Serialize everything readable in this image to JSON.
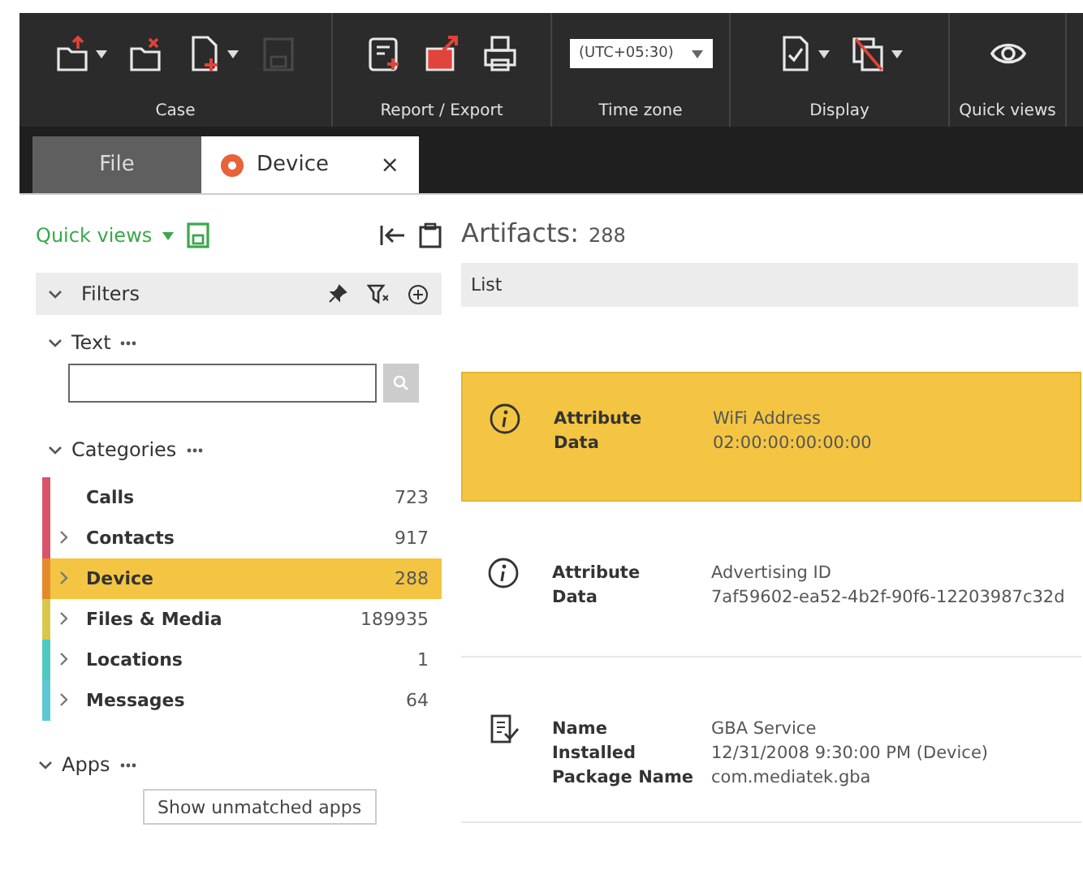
{
  "toolbar": {
    "groups": [
      {
        "label": "Case",
        "buttons": [
          {
            "kind": "open",
            "dropdown": true,
            "disabled": false
          },
          {
            "kind": "close",
            "dropdown": false,
            "disabled": false
          },
          {
            "kind": "new",
            "dropdown": true,
            "disabled": false
          },
          {
            "kind": "save",
            "dropdown": false,
            "disabled": true
          }
        ]
      },
      {
        "label": "Report / Export",
        "buttons": [
          {
            "kind": "report",
            "dropdown": false,
            "disabled": false
          },
          {
            "kind": "export",
            "dropdown": false,
            "disabled": false
          },
          {
            "kind": "print",
            "dropdown": false,
            "disabled": false
          }
        ]
      },
      {
        "label": "Time zone",
        "select": "(UTC+05:30)"
      },
      {
        "label": "Display",
        "buttons": [
          {
            "kind": "doc-check",
            "dropdown": true,
            "disabled": false
          },
          {
            "kind": "copies",
            "dropdown": true,
            "disabled": false
          }
        ]
      },
      {
        "label": "Quick views",
        "buttons": [
          {
            "kind": "eye",
            "dropdown": false,
            "disabled": false
          }
        ]
      }
    ]
  },
  "tabs": [
    {
      "label": "File",
      "selected": false
    },
    {
      "label": "Device",
      "selected": true,
      "close": "×"
    }
  ],
  "sidebar": {
    "quick_views": "Quick views",
    "filters": "Filters",
    "text_section": "Text",
    "categories_title": "Categories",
    "categories": [
      {
        "name": "Calls",
        "count": "723",
        "color": "#d9546a",
        "expandable": false,
        "selected": false
      },
      {
        "name": "Contacts",
        "count": "917",
        "color": "#d9546a",
        "expandable": true,
        "selected": false
      },
      {
        "name": "Device",
        "count": "288",
        "color": "#e48a2a",
        "expandable": true,
        "selected": true
      },
      {
        "name": "Files & Media",
        "count": "189935",
        "color": "#d8c84a",
        "expandable": true,
        "selected": false
      },
      {
        "name": "Locations",
        "count": "1",
        "color": "#4ec9c0",
        "expandable": true,
        "selected": false
      },
      {
        "name": "Messages",
        "count": "64",
        "color": "#5bc8d4",
        "expandable": true,
        "selected": false
      }
    ],
    "apps_title": "Apps",
    "apps_button": "Show unmatched apps"
  },
  "main": {
    "title": "Artifacts:",
    "count": "288",
    "view": "List",
    "artifacts": [
      {
        "kind": "info",
        "selected": true,
        "fields": [
          {
            "label": "Attribute",
            "value": "WiFi Address"
          },
          {
            "label": "Data",
            "value": "02:00:00:00:00:00"
          }
        ]
      },
      {
        "kind": "info",
        "selected": false,
        "fields": [
          {
            "label": "Attribute",
            "value": "Advertising ID"
          },
          {
            "label": "Data",
            "value": "7af59602-ea52-4b2f-90f6-12203987c32d"
          }
        ]
      },
      {
        "kind": "app",
        "selected": false,
        "fields": [
          {
            "label": "Name",
            "value": "GBA Service"
          },
          {
            "label": "Installed",
            "value": "12/31/2008 9:30:00 PM (Device)"
          },
          {
            "label": "Package Name",
            "value": "com.mediatek.gba"
          }
        ]
      }
    ]
  }
}
